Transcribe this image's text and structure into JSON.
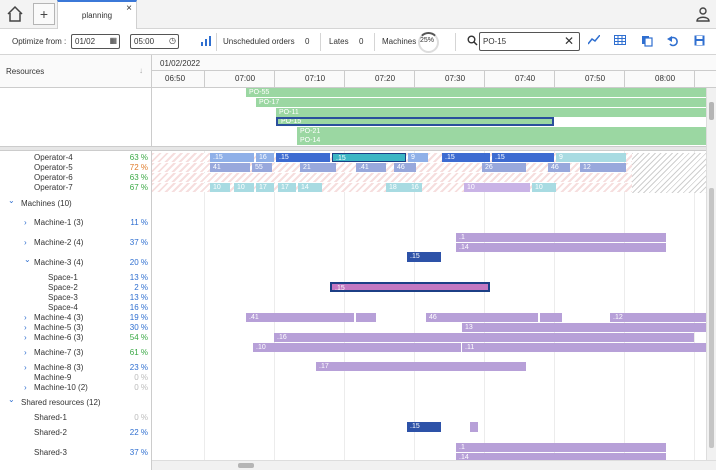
{
  "tabs": {
    "home_icon": "home-icon",
    "add_icon": "plus-icon",
    "active_tab": "planning",
    "close": "×",
    "user_icon": "user-icon"
  },
  "toolbar": {
    "optimize_label": "Optimize from :",
    "date_value": "01/02",
    "time_value": "05:00",
    "unscheduled_label": "Unscheduled orders",
    "unscheduled_count": "0",
    "lates_label": "Lates",
    "lates_count": "0",
    "machines_label": "Machines",
    "machines_pct": "25%",
    "search_value": "PO-15",
    "icons": [
      "chart-icon",
      "grid-icon",
      "copy-icon",
      "undo-icon",
      "save-icon"
    ]
  },
  "left": {
    "header": "Resources"
  },
  "gantt": {
    "date": "01/02/2022",
    "hours": [
      "06:50",
      "07:00",
      "07:10",
      "07:20",
      "07:30",
      "07:40",
      "07:50",
      "08:00"
    ]
  },
  "orders": [
    "PO-55",
    "PO-17",
    "PO-11",
    "PO-15",
    "PO-21",
    "PO-14"
  ],
  "resources": [
    {
      "name": "Operator-4",
      "pct": "63 %",
      "color": "#3aa845",
      "lvl": 1
    },
    {
      "name": "Operator-5",
      "pct": "72 %",
      "color": "#e07b2a",
      "lvl": 1
    },
    {
      "name": "Operator-6",
      "pct": "63 %",
      "color": "#3aa845",
      "lvl": 1
    },
    {
      "name": "Operator-7",
      "pct": "67 %",
      "color": "#3aa845",
      "lvl": 1
    },
    {
      "name": "Machines (10)",
      "pct": "",
      "color": "#333",
      "lvl": 0,
      "chev": "v"
    },
    {
      "name": "Machine-1 (3)",
      "pct": "11 %",
      "color": "#2f6fd0",
      "lvl": 1,
      "chev": ">"
    },
    {
      "name": "Machine-2 (4)",
      "pct": "37 %",
      "color": "#2f6fd0",
      "lvl": 1,
      "chev": ">"
    },
    {
      "name": "Machine-3 (4)",
      "pct": "20 %",
      "color": "#2f6fd0",
      "lvl": 1,
      "chev": "v"
    },
    {
      "name": "Space-1",
      "pct": "13 %",
      "color": "#2f6fd0",
      "lvl": 2
    },
    {
      "name": "Space-2",
      "pct": "2 %",
      "color": "#2f6fd0",
      "lvl": 2
    },
    {
      "name": "Space-3",
      "pct": "13 %",
      "color": "#2f6fd0",
      "lvl": 2
    },
    {
      "name": "Space-4",
      "pct": "16 %",
      "color": "#2f6fd0",
      "lvl": 2
    },
    {
      "name": "Machine-4 (3)",
      "pct": "19 %",
      "color": "#2f6fd0",
      "lvl": 1,
      "chev": ">"
    },
    {
      "name": "Machine-5 (3)",
      "pct": "30 %",
      "color": "#2f6fd0",
      "lvl": 1,
      "chev": ">"
    },
    {
      "name": "Machine-6 (3)",
      "pct": "54 %",
      "color": "#3aa845",
      "lvl": 1,
      "chev": ">"
    },
    {
      "name": "Machine-7 (3)",
      "pct": "61 %",
      "color": "#3aa845",
      "lvl": 1,
      "chev": ">"
    },
    {
      "name": "Machine-8 (3)",
      "pct": "23 %",
      "color": "#2f6fd0",
      "lvl": 1,
      "chev": ">"
    },
    {
      "name": "Machine-9",
      "pct": "0 %",
      "color": "#bbb",
      "lvl": 1
    },
    {
      "name": "Machine-10 (2)",
      "pct": "0 %",
      "color": "#bbb",
      "lvl": 1,
      "chev": ">"
    },
    {
      "name": "Shared resources (12)",
      "pct": "",
      "color": "#333",
      "lvl": 0,
      "chev": "v"
    },
    {
      "name": "Shared-1",
      "pct": "0 %",
      "color": "#bbb",
      "lvl": 1
    },
    {
      "name": "Shared-2",
      "pct": "22 %",
      "color": "#2f6fd0",
      "lvl": 1
    },
    {
      "name": "Shared-3",
      "pct": "37 %",
      "color": "#2f6fd0",
      "lvl": 1
    }
  ],
  "bar_labels": {
    "op4": [
      ".15",
      "16",
      ".15",
      ".15",
      "9",
      ".15",
      ".15",
      "9"
    ],
    "op5": [
      "41",
      "55",
      "21",
      ".41",
      "46",
      "26",
      "46",
      "12"
    ],
    "op7": [
      "10",
      "10",
      "17",
      "17",
      "14",
      "18",
      "16",
      "10",
      "10"
    ],
    "m2": [
      ".1",
      ".14"
    ],
    "m3": [
      ".15"
    ],
    "space2": [
      ".15"
    ],
    "m4": [
      ".41",
      "46",
      ".12"
    ],
    "m5": [
      "13"
    ],
    "m6": [
      ".16"
    ],
    "m7": [
      ".10",
      ".11"
    ],
    "m8": [
      ".17"
    ],
    "shared2": [
      ".15"
    ],
    "shared3": [
      ".1",
      ".14"
    ]
  }
}
